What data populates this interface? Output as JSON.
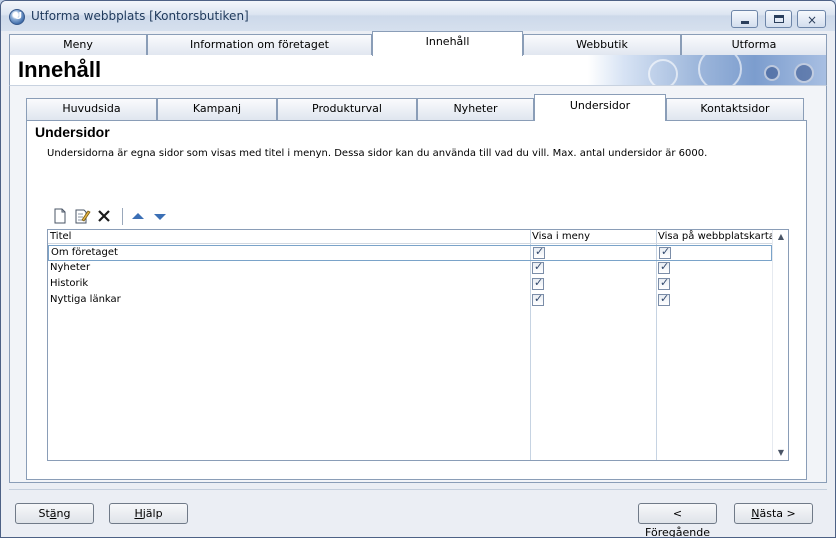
{
  "window": {
    "title": "Utforma webbplats [Kontorsbutiken]",
    "app_icon_letter": "U",
    "controls": {
      "minimize": "minimize",
      "maximize": "maximize",
      "close": "×"
    }
  },
  "main_tabs": [
    "Meny",
    "Information om företaget",
    "Innehåll",
    "Webbutik",
    "Utforma"
  ],
  "main_tab_active": "Innehåll",
  "page_title": "Innehåll",
  "sub_tabs": [
    "Huvudsida",
    "Kampanj",
    "Produkturval",
    "Nyheter",
    "Undersidor",
    "Kontaktsidor"
  ],
  "sub_tab_active": "Undersidor",
  "section": {
    "title": "Undersidor",
    "description": "Undersidorna är egna sidor som visas med titel i menyn. Dessa sidor kan du använda till vad du vill. Max. antal undersidor är 6000."
  },
  "toolbar": {
    "icons": [
      "new-page-icon",
      "edit-page-icon",
      "delete-icon",
      "move-up-icon",
      "move-down-icon"
    ]
  },
  "grid": {
    "columns": [
      "Titel",
      "Visa i meny",
      "Visa på webbplatskarta"
    ],
    "rows": [
      {
        "title": "Om företaget",
        "visa_i_meny": true,
        "visa_pa_karta": true,
        "selected": true
      },
      {
        "title": "Nyheter",
        "visa_i_meny": true,
        "visa_pa_karta": true,
        "selected": false
      },
      {
        "title": "Historik",
        "visa_i_meny": true,
        "visa_pa_karta": true,
        "selected": false
      },
      {
        "title": "Nyttiga länkar",
        "visa_i_meny": true,
        "visa_pa_karta": true,
        "selected": false
      }
    ]
  },
  "footer": {
    "close_prefix": "St",
    "close_accel": "ä",
    "close_suffix": "ng",
    "help_accel": "H",
    "help_suffix": "jälp",
    "prev_prefix": "< ",
    "prev_accel": "F",
    "prev_suffix": "öregående",
    "next_prefix": "",
    "next_accel": "N",
    "next_suffix": "ästa >"
  },
  "colors": {
    "window_border": "#4d6185",
    "tab_border": "#8a9db7",
    "check_mark": "#334a6e",
    "toolbar_arrow": "#3b6fb5"
  }
}
